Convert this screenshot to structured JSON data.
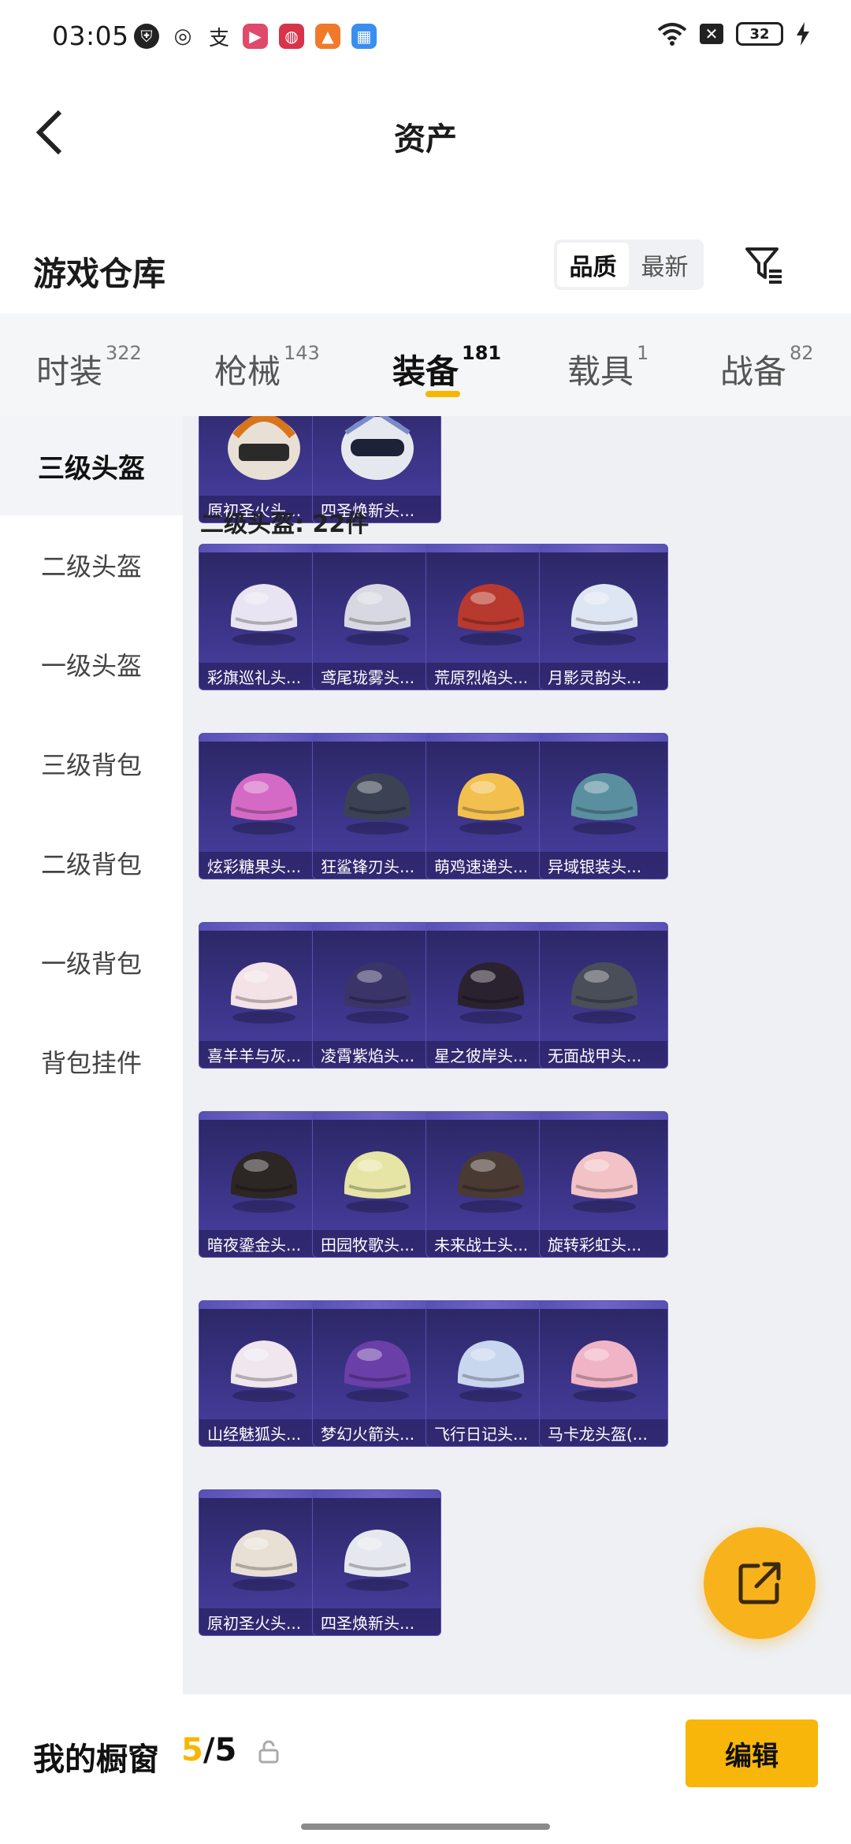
{
  "status_bar": {
    "time": "03:05",
    "battery": "32"
  },
  "header": {
    "title": "资产"
  },
  "section": {
    "title": "游戏仓库",
    "sort_options": [
      "品质",
      "最新"
    ],
    "active_sort": "品质"
  },
  "tabs": [
    {
      "label": "时装",
      "count": "322"
    },
    {
      "label": "枪械",
      "count": "143"
    },
    {
      "label": "装备",
      "count": "181"
    },
    {
      "label": "载具",
      "count": "1"
    },
    {
      "label": "战备",
      "count": "82"
    }
  ],
  "active_tab": "装备",
  "sidebar": {
    "items": [
      "三级头盔",
      "二级头盔",
      "一级头盔",
      "三级背包",
      "二级背包",
      "一级背包",
      "背包挂件"
    ],
    "active": "三级头盔"
  },
  "content": {
    "top_partial_items": [
      "原初圣火头...",
      "四圣焕新头..."
    ],
    "group_header": "二级头盔: 22件",
    "items": [
      {
        "name": "彩旗巡礼头...",
        "color": "#e8e4f2"
      },
      {
        "name": "鸢尾珑雾头...",
        "color": "#d8d8e2"
      },
      {
        "name": "荒原烈焰头...",
        "color": "#b8392e"
      },
      {
        "name": "月影灵韵头...",
        "color": "#dfe6f3"
      },
      {
        "name": "炫彩糖果头...",
        "color": "#d56ac6"
      },
      {
        "name": "狂鲨锋刃头...",
        "color": "#3c4254"
      },
      {
        "name": "萌鸡速递头...",
        "color": "#f3c04f"
      },
      {
        "name": "异域银装头...",
        "color": "#5a8fa0"
      },
      {
        "name": "喜羊羊与灰...",
        "color": "#f3e2e6"
      },
      {
        "name": "凌霄紫焰头...",
        "color": "#3a3568"
      },
      {
        "name": "星之彼岸头...",
        "color": "#2b2230"
      },
      {
        "name": "无面战甲头...",
        "color": "#4a4e58"
      },
      {
        "name": "暗夜鎏金头...",
        "color": "#2c2624"
      },
      {
        "name": "田园牧歌头...",
        "color": "#e6e5a5"
      },
      {
        "name": "未来战士头...",
        "color": "#4a3a34"
      },
      {
        "name": "旋转彩虹头...",
        "color": "#f3c2c6"
      },
      {
        "name": "山经魅狐头...",
        "color": "#efe6ee"
      },
      {
        "name": "梦幻火箭头...",
        "color": "#6a3fa8"
      },
      {
        "name": "飞行日记头...",
        "color": "#c8d6ee"
      },
      {
        "name": "马卡龙头盔(...",
        "color": "#f0b4c6"
      },
      {
        "name": "原初圣火头...",
        "color": "#e8e0d4"
      },
      {
        "name": "四圣焕新头...",
        "color": "#e6e8ef"
      }
    ]
  },
  "bottom_bar": {
    "label": "我的橱窗",
    "current": "5",
    "separator_total": "/5",
    "edit_label": "编辑"
  },
  "colors": {
    "accent": "#f7b600",
    "card_bg": "#3b3488"
  }
}
